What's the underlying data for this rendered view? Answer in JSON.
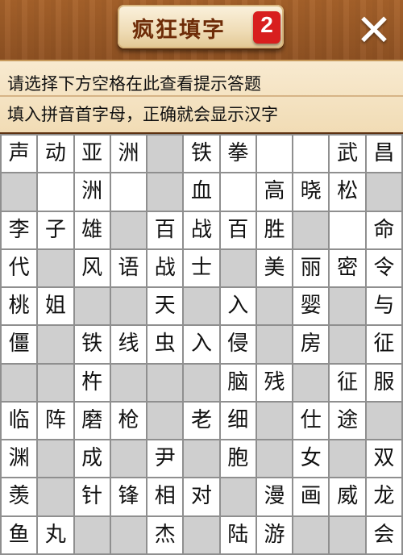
{
  "header": {
    "title": "疯狂填字",
    "level": "2",
    "close_icon": "close-icon"
  },
  "hint": {
    "line1": "请选择下方空格在此查看提示答题",
    "line2": "填入拼音首字母，正确就会显示汉字"
  },
  "grid": [
    [
      "声",
      "动",
      "亚",
      "洲",
      null,
      "铁",
      "拳",
      "",
      "",
      "武",
      "昌"
    ],
    [
      null,
      "",
      "洲",
      "",
      null,
      "血",
      "",
      "高",
      "晓",
      "松",
      null
    ],
    [
      "李",
      "子",
      "雄",
      null,
      "百",
      "战",
      "百",
      "胜",
      null,
      "",
      "命"
    ],
    [
      "代",
      null,
      "风",
      "语",
      "战",
      "士",
      null,
      "美",
      "丽",
      "密",
      "令"
    ],
    [
      "桃",
      "姐",
      null,
      null,
      "天",
      null,
      "入",
      null,
      "婴",
      null,
      "与"
    ],
    [
      "僵",
      null,
      "铁",
      "线",
      "虫",
      "入",
      "侵",
      null,
      "房",
      null,
      "征"
    ],
    [
      null,
      null,
      "杵",
      null,
      null,
      null,
      "脑",
      "残",
      null,
      "征",
      "服"
    ],
    [
      "临",
      "阵",
      "磨",
      "枪",
      null,
      "老",
      "细",
      null,
      "仕",
      "途",
      null
    ],
    [
      "渊",
      null,
      "成",
      null,
      "尹",
      null,
      "胞",
      null,
      "女",
      null,
      "双"
    ],
    [
      "羡",
      null,
      "针",
      "锋",
      "相",
      "对",
      null,
      "漫",
      "画",
      "威",
      "龙"
    ],
    [
      "鱼",
      "丸",
      null,
      null,
      "杰",
      null,
      "陆",
      "游",
      null,
      null,
      "会"
    ]
  ],
  "colors": {
    "cell_white": "#ffffff",
    "cell_gray": "#cfcfcf",
    "grid_line": "#8f8f8f",
    "badge": "#d81e1e",
    "title_text": "#6e2c08"
  }
}
